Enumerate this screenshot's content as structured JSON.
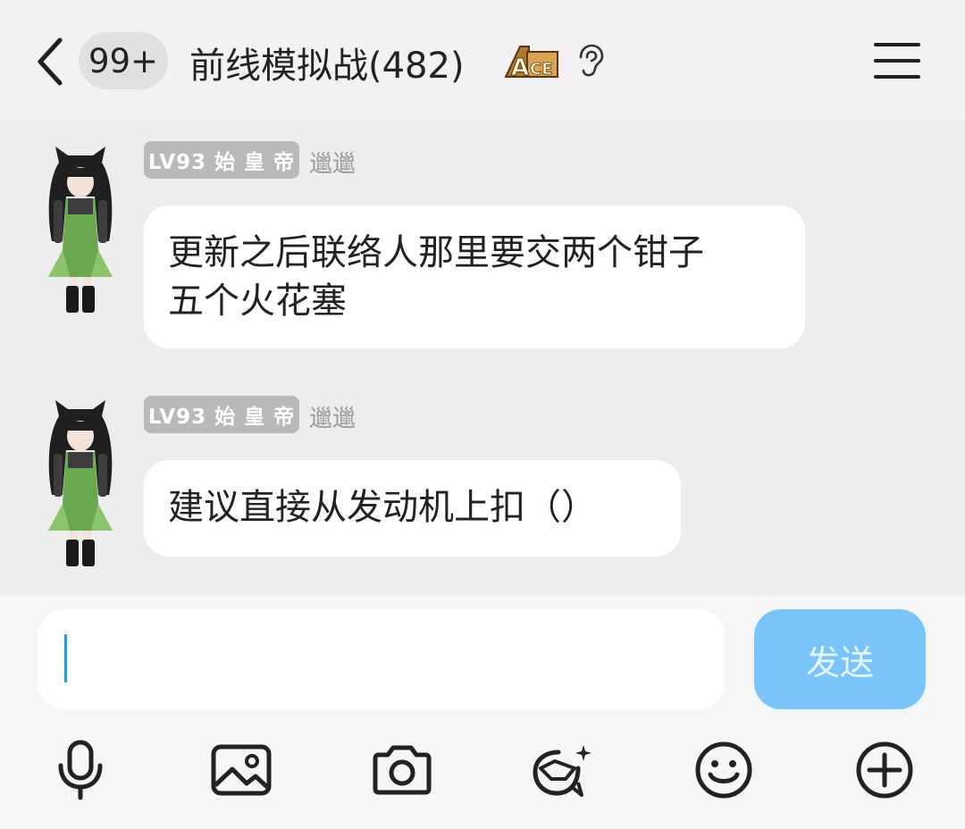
{
  "header": {
    "unread_count": "99+",
    "title": "前线模拟战(482)",
    "badge_icon": "ace-badge-icon",
    "listen_icon": "ear-icon",
    "menu_icon": "menu-icon"
  },
  "messages": [
    {
      "level": "LV93 始 皇 帝",
      "nickname": "邋邋",
      "text_line1": "更新之后联络人那里要交两个钳子",
      "text_line2": "五个火花塞"
    },
    {
      "level": "LV93 始 皇 帝",
      "nickname": "邋邋",
      "text_line1": "建议直接从发动机上扣（）"
    }
  ],
  "composer": {
    "value": "",
    "send_label": "发送"
  },
  "toolbar": [
    "microphone-icon",
    "image-icon",
    "camera-icon",
    "sticker-icon",
    "emoji-icon",
    "plus-icon"
  ],
  "colors": {
    "header_bg": "#f4f1f5",
    "chat_bg": "#ededed",
    "bubble_bg": "#ffffff",
    "send_button": "#79c4fb",
    "level_badge": "#b9b9b9"
  }
}
